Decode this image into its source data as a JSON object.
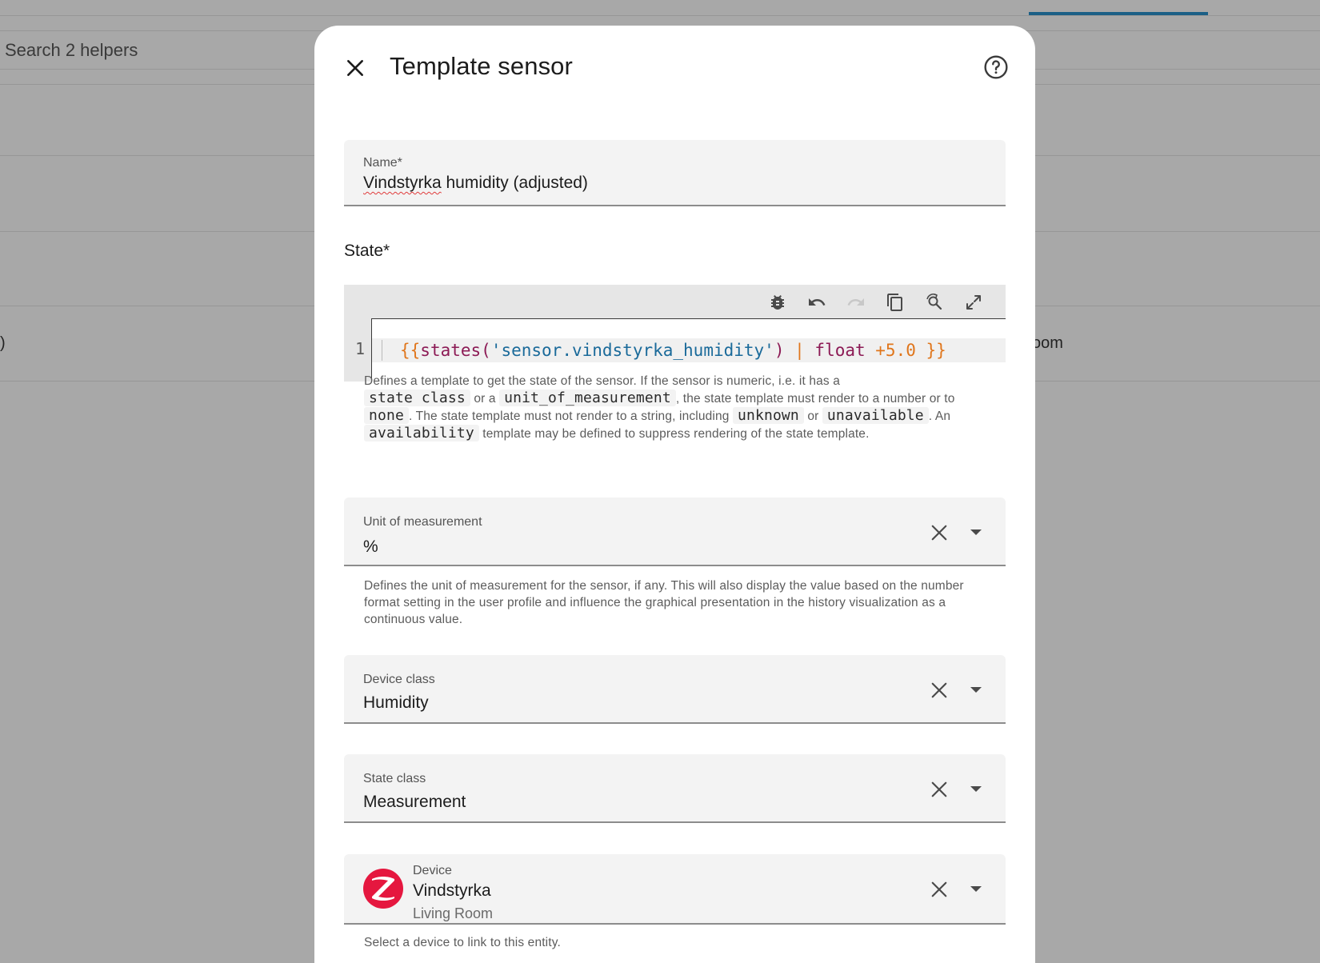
{
  "background": {
    "search_placeholder": "Search 2 helpers",
    "row_text_left": ")",
    "row_text_right": "oom"
  },
  "dialog": {
    "title": "Template sensor",
    "close_icon": "close-icon",
    "help_icon": "help-circle-icon"
  },
  "name_field": {
    "label": "Name*",
    "value_misspelled": "Vindstyrka",
    "value_rest": " humidity (adjusted)"
  },
  "state": {
    "label": "State*",
    "toolbar_icons": [
      "bug-icon",
      "undo-icon",
      "redo-icon",
      "copy-icon",
      "search-replace-icon",
      "fullscreen-icon"
    ],
    "line_number": "1",
    "code": {
      "open": "{{",
      "func": "states(",
      "str": "'sensor.vindstyrka_humidity'",
      "close_paren": ")",
      "pipe": " | ",
      "filter": "float",
      "num": " +5.0",
      "close": " }}"
    },
    "helper": {
      "p1": "Defines a template to get the state of the sensor. If the sensor is numeric, i.e. it has a",
      "c1": "state class",
      "p2": " or a ",
      "c2": "unit_of_measurement",
      "p3": ", the state template must render to a number or to ",
      "c3": "none",
      "p4": ". The state template must not render to a string, including ",
      "c4": "unknown",
      "p5": " or ",
      "c5": "unavailable",
      "p6": ". An ",
      "c6": "availability",
      "p7": " template may be defined to suppress rendering of the state template."
    }
  },
  "unit_field": {
    "label": "Unit of measurement",
    "value": "%",
    "helper": "Defines the unit of measurement for the sensor, if any. This will also display the value based on the number format setting in the user profile and influence the graphical presentation in the history visualization as a continuous value."
  },
  "device_class_field": {
    "label": "Device class",
    "value": "Humidity"
  },
  "state_class_field": {
    "label": "State class",
    "value": "Measurement"
  },
  "device_field": {
    "label": "Device",
    "value": "Vindstyrka",
    "area": "Living Room",
    "logo_icon": "zigbee-logo-icon",
    "helper": "Select a device to link to this entity."
  },
  "colors": {
    "accent": "#1b5f86",
    "zigbee": "#e5173f"
  }
}
